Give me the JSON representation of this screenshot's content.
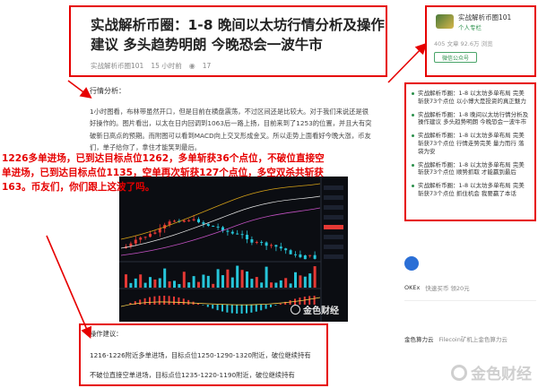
{
  "article": {
    "title": "实战解析币圈：1-8 晚间以太坊行情分析及操作建议 多头趋势明朗 今晚恐会一波牛市",
    "author": "实战解析币圈101",
    "time": "15 小时前",
    "views": "17",
    "section_label": "行情分析：",
    "paragraphs": [
      "1小时图看，布林带虽然开口，但是目前在横盘震荡，不过区间还是比较大。对于我们来说还是很好操作的。图片看出，以太在日内回调到1063后一路上扬，目前来到了1253的位置，并且大有突破新日高点的预期。而附图可以看到MACD向上交叉形成金叉。所以走势上面看好今晚大涨，币友们，单子给你了，拿住才能笑到最后。"
    ]
  },
  "annotation": "1226多单进场，已到达目标点位1262，多单斩获36个点位，不破位直接空单进场，已到达目标点位1135，空单再次斩获127个点位，多空双杀共斩获163。币友们，你们跟上这波了吗。",
  "chart_image": {
    "watermark": "金色财经"
  },
  "advice": {
    "heading": "操作建议：",
    "line1": "1216-1226附近多单进场，目标点位1250-1290-1320附近，破位继续持有",
    "line2": "不破位直接空单进场，目标点位1235-1220-1190附近，破位继续持有"
  },
  "sidebar": {
    "author_name": "实战解析币圈101",
    "author_tag": "个人专栏",
    "stats": "405 文章  92.6万 浏览",
    "follow_label": "微信公众号",
    "related": [
      "实战解析币圈：1-8 以太坊多单布局 完美斩获73个点位 以小博大是投资的真正魅力",
      "实战解析币圈：1-8 晚间以太坊行情分析及操作建议 多头趋势明朗 今晚恐会一波牛市",
      "实战解析币圈：1-8 以太坊多单布局 完美斩获73个点位 行情走势完美 量力而行 落袋为安",
      "实战解析币圈：1-8 以太坊多单布局 完美斩获73个点位 顺势抓取 才能赢到最后",
      "实战解析币圈：1-8 以太坊多单布局 完美斩获73个点位 抓住机会 我要赢了本话"
    ],
    "ads": [
      {
        "name": "OKEx",
        "sub": "快速买币 领20元"
      },
      {
        "name": "金色算力云",
        "sub": "Filecoin矿机上金色算力云"
      }
    ]
  },
  "watermark": "金色财经",
  "colors": {
    "highlight_red": "#e60000",
    "accent_green": "#2a8f4a"
  }
}
